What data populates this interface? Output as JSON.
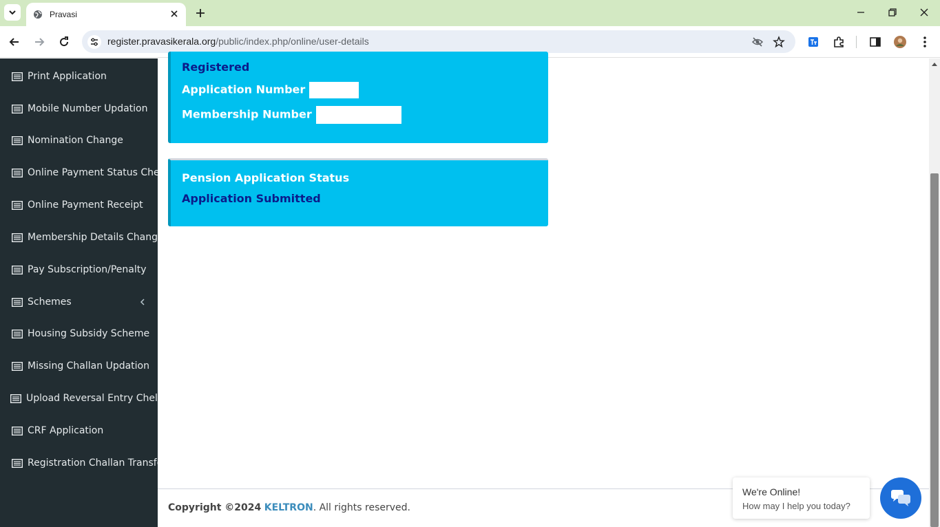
{
  "browser": {
    "tab_title": "Pravasi",
    "url_host": "register.pravasikerala.org",
    "url_path": "/public/index.php/online/user-details"
  },
  "sidebar": {
    "items": [
      {
        "label": "Print Application"
      },
      {
        "label": "Mobile Number Updation"
      },
      {
        "label": "Nomination Change"
      },
      {
        "label": "Online Payment Status Check"
      },
      {
        "label": "Online Payment Receipt"
      },
      {
        "label": "Membership Details Change"
      },
      {
        "label": "Pay Subscription/Penalty"
      },
      {
        "label": "Schemes"
      },
      {
        "label": "Housing Subsidy Scheme"
      },
      {
        "label": "Missing Challan Updation"
      },
      {
        "label": "Upload Reversal Entry Chellan"
      },
      {
        "label": "CRF Application"
      },
      {
        "label": "Registration Challan Transfer"
      }
    ]
  },
  "registration_box": {
    "status": "Registered",
    "application_number_label": "Application Number -",
    "membership_number_label": "Membership Number -"
  },
  "pension_box": {
    "title": "Pension Application Status",
    "status": "Application Submitted"
  },
  "footer": {
    "copyright": "Copyright ©2024",
    "brand": "KELTRON",
    "suffix": ". All rights reserved."
  },
  "chat": {
    "title": "We're Online!",
    "subtitle": "How may I help you today?"
  },
  "colors": {
    "sidebar_bg": "#222d32",
    "info_box": "#00c0ef",
    "dark_text": "#0b1b8a",
    "brand_link": "#3c8dbc",
    "chat_button": "#1e6fd9"
  }
}
